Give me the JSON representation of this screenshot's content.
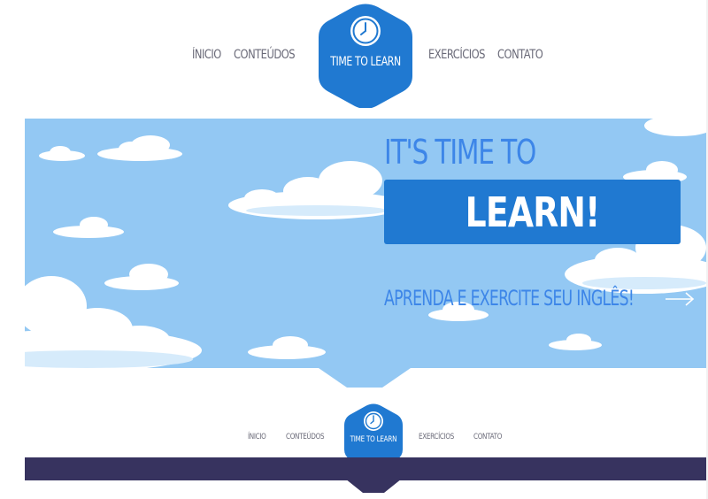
{
  "colors": {
    "brand_blue": "#2079d1",
    "sky": "#93c8f3",
    "title_blue": "#3d86e8",
    "nav_text": "#6a6a78",
    "dark_bar": "#37335f"
  },
  "nav_top": {
    "logo_text": "TIME TO LEARN",
    "logo_icon": "clock-icon",
    "items": [
      {
        "label": "ÍNICIO"
      },
      {
        "label": "CONTEÚDOS"
      },
      {
        "label": "EXERCÍCIOS"
      },
      {
        "label": "CONTATO"
      }
    ]
  },
  "hero": {
    "title": "IT'S TIME TO",
    "highlight": "LEARN!",
    "subtitle": "APRENDA E EXERCITE SEU INGLÊS!",
    "arrow_icon": "arrow-right-icon"
  },
  "nav_bottom": {
    "logo_text": "TIME TO LEARN",
    "logo_icon": "clock-icon",
    "items": [
      {
        "label": "ÍNICIO"
      },
      {
        "label": "CONTEÚDOS"
      },
      {
        "label": "EXERCÍCIOS"
      },
      {
        "label": "CONTATO"
      }
    ]
  }
}
